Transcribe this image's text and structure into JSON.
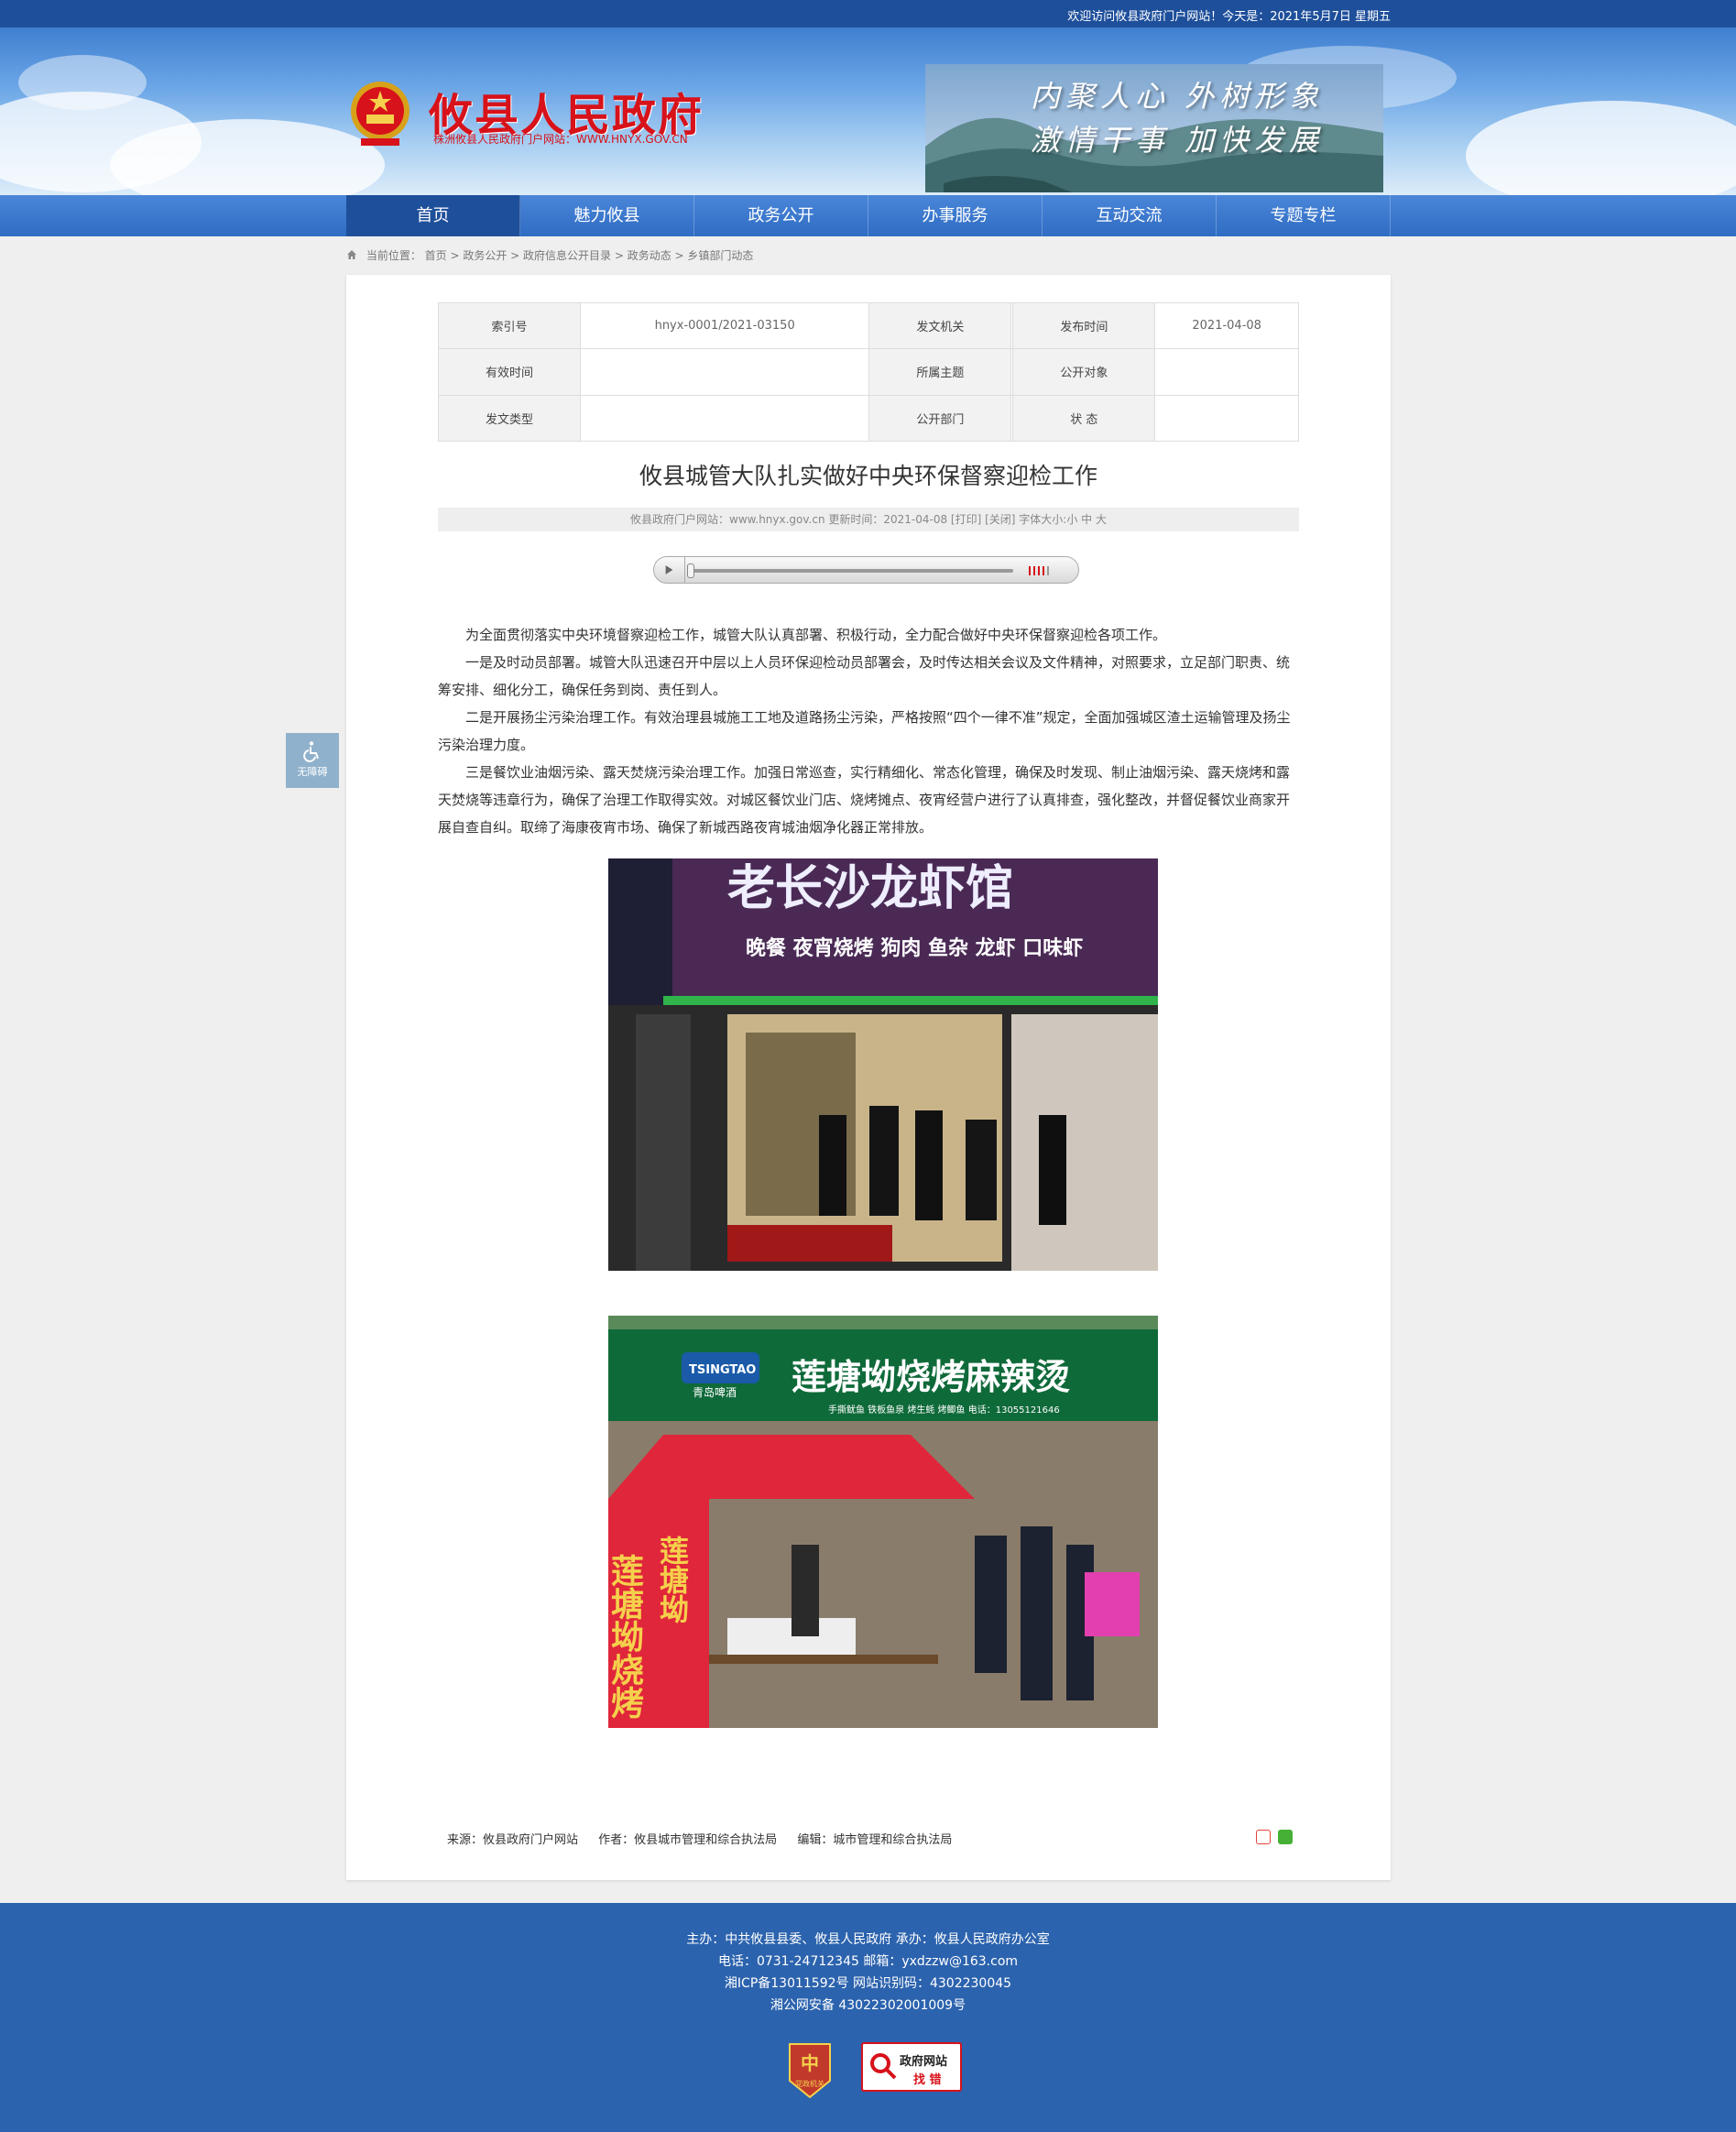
{
  "topbar": {
    "welcome": "欢迎访问攸县政府门户网站！今天是：2021年5月7日 星期五"
  },
  "header": {
    "title": "攸县人民政府",
    "subtitle": "株洲攸县人民政府门户网站：WWW.HNYX.GOV.CN",
    "slogan_line1": "内聚人心  外树形象",
    "slogan_line2": "激情干事  加快发展"
  },
  "nav": {
    "items": [
      "首页",
      "魅力攸县",
      "政务公开",
      "办事服务",
      "互动交流",
      "专题专栏"
    ]
  },
  "breadcrumb": {
    "prefix": "当前位置：",
    "path": "首页 > 政务公开 > 政府信息公开目录 > 政务动态 > 乡镇部门动态"
  },
  "meta_table": {
    "rows": [
      [
        {
          "k": "索引号",
          "v": "hnyx-0001/2021-03150"
        },
        {
          "k": "发文机关",
          "v": ""
        },
        {
          "k": "发布时间",
          "v": "2021-04-08"
        }
      ],
      [
        {
          "k": "有效时间",
          "v": ""
        },
        {
          "k": "所属主题",
          "v": ""
        },
        {
          "k": "公开对象",
          "v": ""
        }
      ],
      [
        {
          "k": "发文类型",
          "v": ""
        },
        {
          "k": "公开部门",
          "v": ""
        },
        {
          "k": "状 态",
          "v": ""
        }
      ]
    ]
  },
  "article": {
    "title": "攸县城管大队扎实做好中央环保督察迎检工作",
    "info": "攸县政府门户网站：www.hnyx.gov.cn   更新时间：2021-04-08  [打印] [关闭]  字体大小:小 中 大",
    "paragraphs": [
      "为全面贯彻落实中央环境督察迎检工作，城管大队认真部署、积极行动，全力配合做好中央环保督察迎检各项工作。",
      "一是及时动员部署。城管大队迅速召开中层以上人员环保迎检动员部署会，及时传达相关会议及文件精神，对照要求，立足部门职责、统筹安排、细化分工，确保任务到岗、责任到人。",
      "二是开展扬尘污染治理工作。有效治理县城施工工地及道路扬尘污染，严格按照“四个一律不准”规定，全面加强城区渣土运输管理及扬尘污染治理力度。",
      "三是餐饮业油烟污染、露天焚烧污染治理工作。加强日常巡查，实行精细化、常态化管理，确保及时发现、制止油烟污染、露天烧烤和露天焚烧等违章行为，确保了治理工作取得实效。对城区餐饮业门店、烧烤摊点、夜宵经营户进行了认真排查，强化整改，并督促餐饮业商家开展自查自纠。取缔了海康夜宵市场、确保了新城西路夜宵城油烟净化器正常排放。"
    ],
    "photo1": {
      "sign": "老长沙龙虾馆",
      "strip": "晚餐 夜宵烧烤 狗肉 鱼杂 龙虾 口味虾"
    },
    "photo2": {
      "brand": "TSINGTAO",
      "brand_cn": "青岛啤酒",
      "sign": "莲塘坳烧烤麻辣烫",
      "phone": "手撕鱿鱼 铁板鱼泉 烤生蚝 烤鲫鱼 电话：13055121646",
      "banner": "莲塘坳烧烤",
      "banner2": "莲塘坳"
    },
    "source": "来源：攸县政府门户网站",
    "author": "作者：攸县城市管理和综合执法局",
    "editor": "编辑：城市管理和综合执法局"
  },
  "accessibility": {
    "label": "无障碍"
  },
  "footer": {
    "line1": "主办：中共攸县县委、攸县人民政府 承办：攸县人民政府办公室",
    "line2": "电话：0731-24712345 邮箱：yxdzzw@163.com",
    "line3": "湘ICP备13011592号    网站识别码：4302230045",
    "line4": "湘公网安备 43022302001009号",
    "badge1_label": "党政机关",
    "badge2_line1": "政府网站",
    "badge2_line2": "找 错"
  },
  "colors": {
    "primary": "#2c63ae",
    "nav_active": "#1e4f9b",
    "title_red": "#d7121a"
  }
}
